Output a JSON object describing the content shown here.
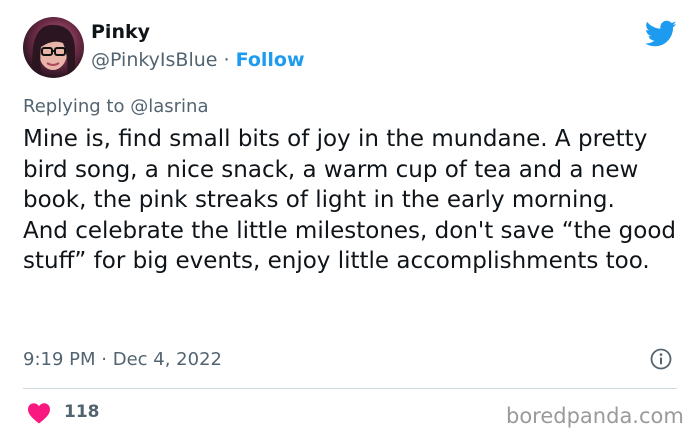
{
  "author": {
    "name": "Pinky",
    "handle": "@PinkyIsBlue",
    "separator": "·",
    "follow_label": "Follow"
  },
  "reply": {
    "prefix": "Replying to",
    "mention": "@lasrina"
  },
  "tweet": {
    "paragraph1": "Mine is, find small bits of joy in the mundane. A pretty bird song, a nice snack, a warm cup of tea and a new book, the pink streaks of light in the early morning.",
    "paragraph2": "And celebrate the little milestones, don't save “the good stuff” for big events, enjoy little accomplishments too."
  },
  "meta": {
    "time": "9:19 PM",
    "separator": "·",
    "date": "Dec 4, 2022"
  },
  "engagement": {
    "likes": "118"
  },
  "watermark": "boredpanda.com",
  "colors": {
    "accent": "#1d9bf0",
    "heart": "#f91880",
    "secondary_text": "#536471"
  },
  "icons": {
    "brand": "twitter-bird-icon",
    "info": "info-icon",
    "like": "heart-icon"
  }
}
